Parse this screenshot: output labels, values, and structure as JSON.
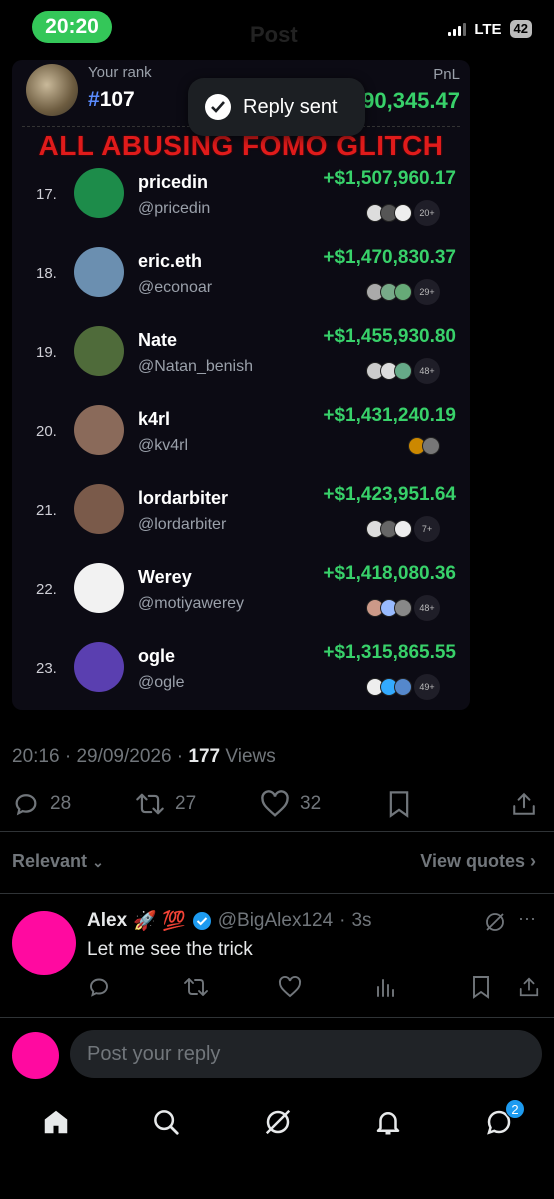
{
  "status_bar": {
    "time": "20:20",
    "network": "LTE",
    "battery": "42"
  },
  "header": {
    "title": "Post"
  },
  "toast": {
    "text": "Reply sent"
  },
  "leaderboard": {
    "your_rank_label": "Your rank",
    "your_rank_hash": "#",
    "your_rank_value": "107",
    "pnl_label": "PnL",
    "pnl_value": "90,345.47",
    "banner": "ALL ABUSING FOMO GLITCH",
    "rows": [
      {
        "rank": "17.",
        "name": "pricedin",
        "handle": "@pricedin",
        "pnl": "+$1,507,960.17",
        "more": "20+",
        "avatar_color": "#1d8c4a"
      },
      {
        "rank": "18.",
        "name": "eric.eth",
        "handle": "@econoar",
        "pnl": "+$1,470,830.37",
        "more": "29+",
        "avatar_color": "#6b8fb0"
      },
      {
        "rank": "19.",
        "name": "Nate",
        "handle": "@Natan_benish",
        "pnl": "+$1,455,930.80",
        "more": "48+",
        "avatar_color": "#4f6b3a"
      },
      {
        "rank": "20.",
        "name": "k4rl",
        "handle": "@kv4rl",
        "pnl": "+$1,431,240.19",
        "more": "",
        "avatar_color": "#8a6a5a"
      },
      {
        "rank": "21.",
        "name": "lordarbiter",
        "handle": "@lordarbiter",
        "pnl": "+$1,423,951.64",
        "more": "7+",
        "avatar_color": "#7a5a4a"
      },
      {
        "rank": "22.",
        "name": "Werey",
        "handle": "@motiyawerey",
        "pnl": "+$1,418,080.36",
        "more": "48+",
        "avatar_color": "#f2f2f2"
      },
      {
        "rank": "23.",
        "name": "ogle",
        "handle": "@ogle",
        "pnl": "+$1,315,865.55",
        "more": "49+",
        "avatar_color": "#5a3fb0"
      }
    ]
  },
  "post": {
    "time": "20:16",
    "date": "29/09/2026",
    "views_count": "177",
    "views_label": "Views",
    "replies": "28",
    "reposts": "27",
    "likes": "32"
  },
  "replies_header": {
    "sort_label": "Relevant",
    "view_quotes": "View quotes"
  },
  "reply": {
    "name": "Alex",
    "emoji": "🚀 💯",
    "handle": "@BigAlex124",
    "age": "3s",
    "text": "Let me see the trick",
    "more": "···"
  },
  "compose": {
    "placeholder": "Post your reply"
  },
  "tab_bar": {
    "messages_badge": "2"
  },
  "colors": {
    "accent": "#1d9bf0",
    "profit_green": "#38d16a",
    "banner_red": "#e01b1b",
    "avatar_pink": "#ff0aa0",
    "time_pill": "#34c759"
  }
}
